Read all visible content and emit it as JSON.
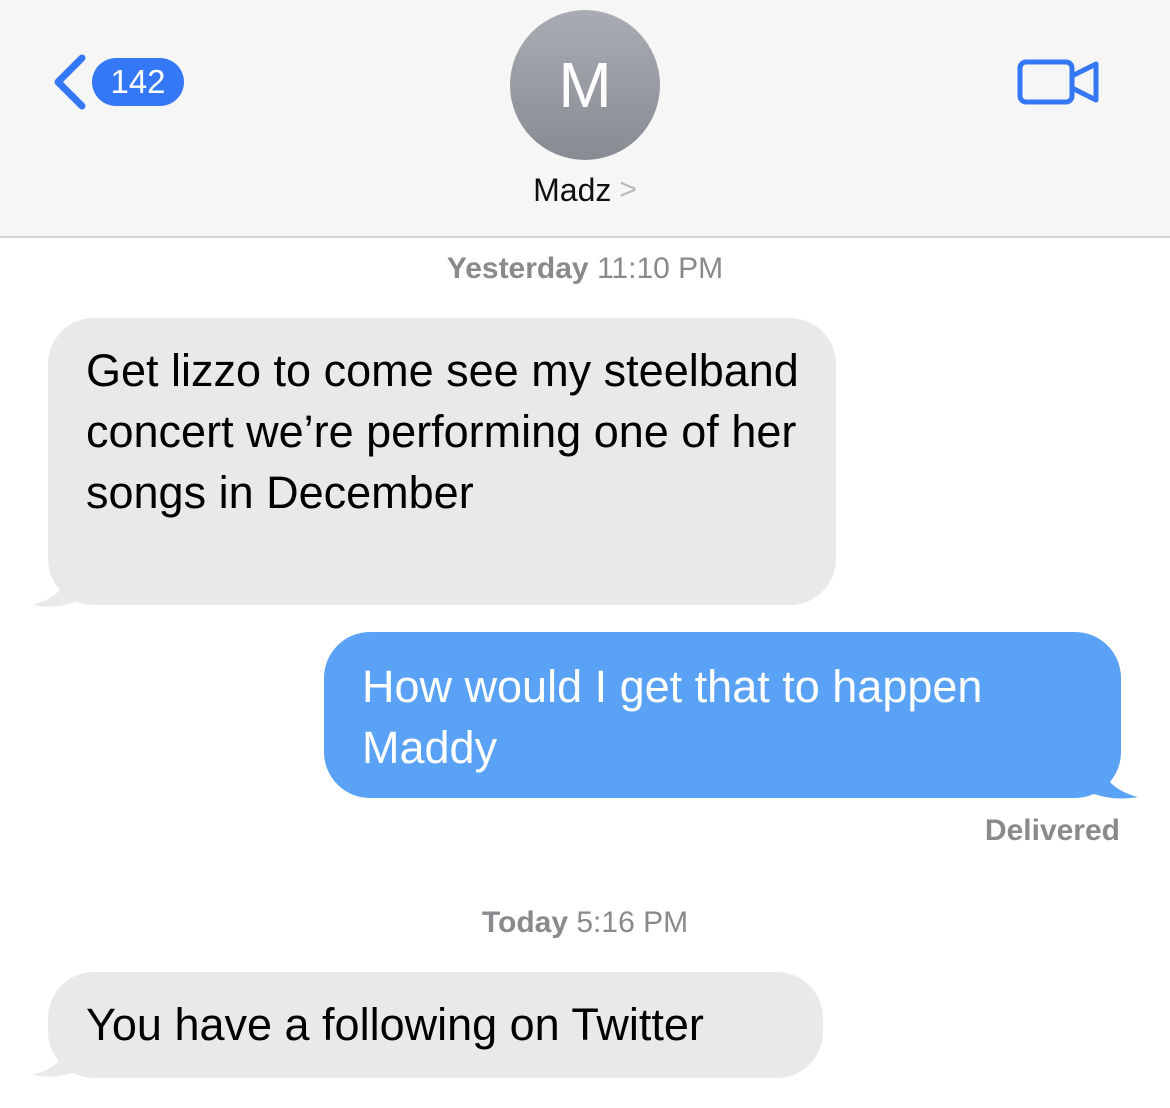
{
  "header": {
    "back_badge_count": "142",
    "avatar_initial": "M",
    "contact_name": "Madz",
    "contact_chevron": ">"
  },
  "timestamps": [
    {
      "day": "Yesterday",
      "time": "11:10 PM"
    },
    {
      "day": "Today",
      "time": "5:16 PM"
    }
  ],
  "messages": [
    {
      "direction": "incoming",
      "text": "Get lizzo to come see my steelband concert we’re performing one of her songs in December"
    },
    {
      "direction": "outgoing",
      "text": "How would I get that to happen Maddy"
    },
    {
      "direction": "incoming",
      "text": "You have a following on Twitter"
    }
  ],
  "delivery_status": "Delivered",
  "colors": {
    "accent": "#3478f6",
    "outgoing_bubble": "#5aa2f5",
    "incoming_bubble": "#e9e9eb",
    "header_bg": "#f6f6f6",
    "meta_text": "#8a8a8e"
  },
  "icons": {
    "back": "chevron-left-icon",
    "video": "video-camera-icon"
  }
}
